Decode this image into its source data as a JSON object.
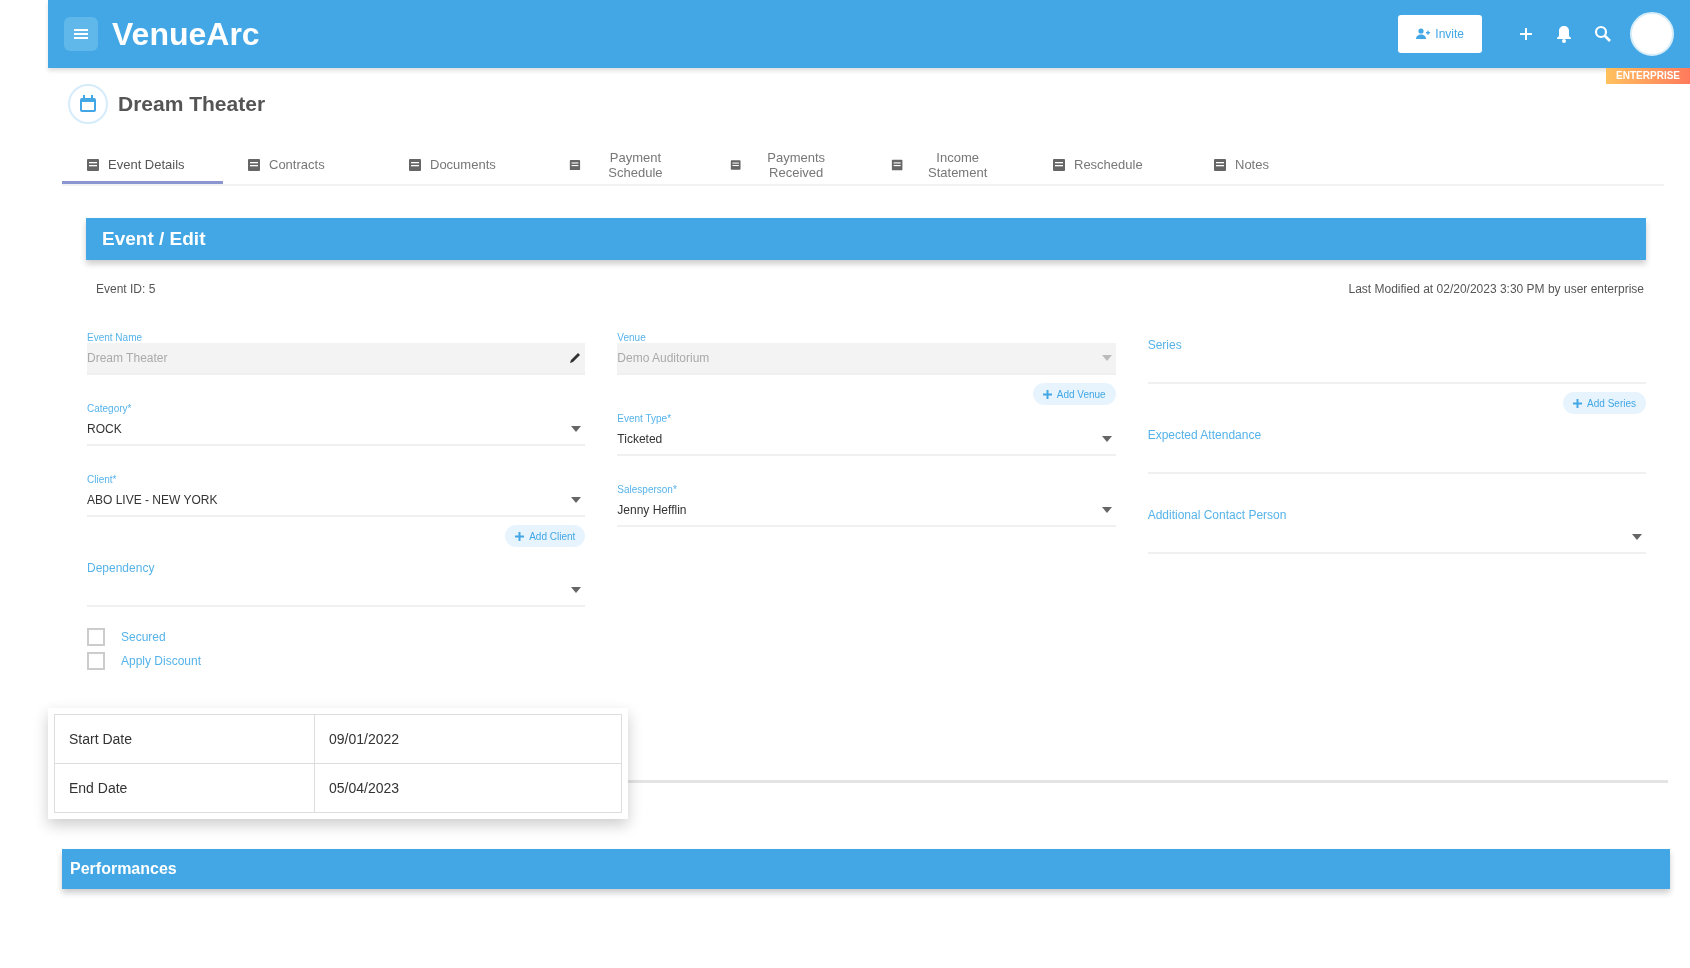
{
  "header": {
    "logo": "VenueArc",
    "invite_button": "Invite",
    "plan_badge": "ENTERPRISE"
  },
  "page": {
    "title": "Dream Theater"
  },
  "tabs": [
    {
      "label": "Event Details",
      "selected": true
    },
    {
      "label": "Contracts",
      "selected": false
    },
    {
      "label": "Documents",
      "selected": false
    },
    {
      "label": "Payment Schedule",
      "selected": false
    },
    {
      "label": "Payments Received",
      "selected": false
    },
    {
      "label": "Income Statement",
      "selected": false
    },
    {
      "label": "Reschedule",
      "selected": false
    },
    {
      "label": "Notes",
      "selected": false
    }
  ],
  "edit_panel": {
    "title": "Event / Edit",
    "event_id": "Event ID: 5",
    "last_modified": "Last Modified at 02/20/2023 3:30 PM by user enterprise",
    "columns": [
      [
        {
          "kind": "text",
          "label": "Event Name",
          "value": "Dream Theater",
          "disabled": true
        },
        {
          "kind": "select",
          "label": "Category*",
          "value": "ROCK"
        },
        {
          "kind": "select",
          "label": "Client*",
          "value": "ABO LIVE - NEW YORK"
        },
        {
          "kind": "add",
          "label": "Add Client"
        },
        {
          "kind": "select",
          "label": "Dependency"
        },
        {
          "kind": "checkbox",
          "label": "Secured",
          "checked": false
        },
        {
          "kind": "checkbox",
          "label": "Apply Discount",
          "checked": false
        }
      ],
      [
        {
          "kind": "select",
          "label": "Venue",
          "value": "Demo Auditorium",
          "disabled": true
        },
        {
          "kind": "add",
          "label": "Add Venue"
        },
        {
          "kind": "select",
          "label": "Event Type*",
          "value": "Ticketed"
        },
        {
          "kind": "select",
          "label": "Salesperson*",
          "value": "Jenny Hefflin"
        }
      ],
      [
        {
          "kind": "text",
          "label": "Series"
        },
        {
          "kind": "add",
          "label": "Add Series"
        },
        {
          "kind": "text",
          "label": "Expected Attendance"
        },
        {
          "kind": "select",
          "label": "Additional Contact Person"
        }
      ]
    ]
  },
  "date_popup": {
    "rows": [
      {
        "label": "Start Date",
        "value": "09/01/2022"
      },
      {
        "label": "End Date",
        "value": "05/04/2023"
      }
    ]
  },
  "performances": {
    "title": "Performances"
  }
}
